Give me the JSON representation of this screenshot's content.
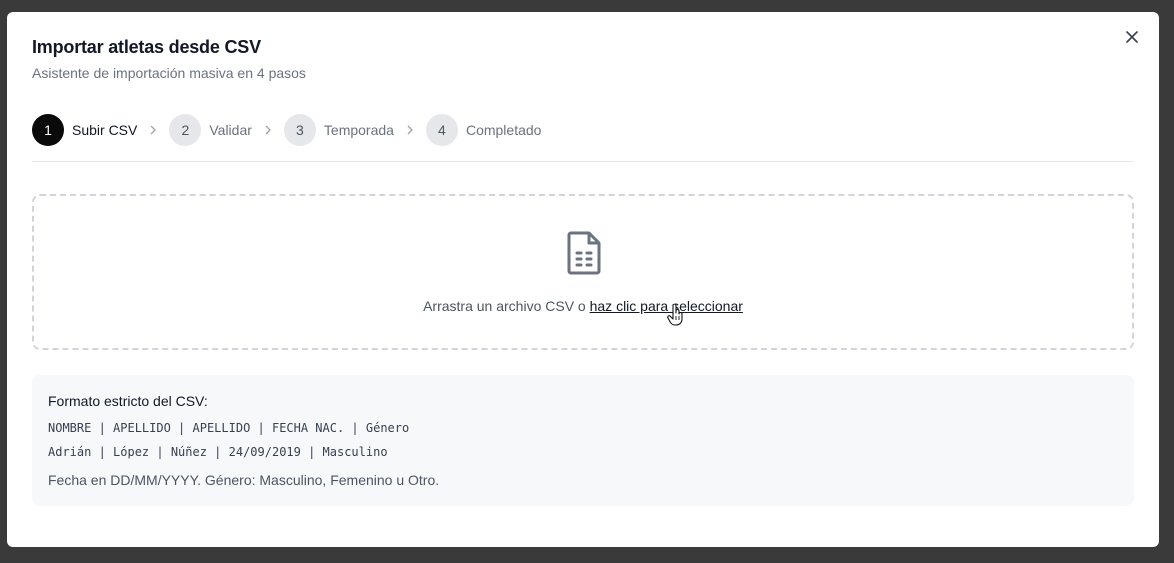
{
  "dialog": {
    "title": "Importar atletas desde CSV",
    "subtitle": "Asistente de importación masiva en 4 pasos",
    "close_icon": "close-icon"
  },
  "steps": [
    {
      "number": "1",
      "label": "Subir CSV",
      "active": true
    },
    {
      "number": "2",
      "label": "Validar",
      "active": false
    },
    {
      "number": "3",
      "label": "Temporada",
      "active": false
    },
    {
      "number": "4",
      "label": "Completado",
      "active": false
    }
  ],
  "dropzone": {
    "icon": "file-spreadsheet-icon",
    "text": "Arrastra un archivo CSV o ",
    "link": "haz clic para seleccionar"
  },
  "format": {
    "title": "Formato estricto del CSV:",
    "header_line": "NOMBRE | APELLIDO | APELLIDO | FECHA NAC. | Género",
    "example_line": "Adrián | López | Núñez | 24/09/2019 | Masculino",
    "note": "Fecha en DD/MM/YYYY. Género: Masculino, Femenino u Otro."
  },
  "colors": {
    "active_step": "#0a0a0a",
    "inactive_step": "#e5e7eb",
    "backdrop": "#3a3a3a"
  }
}
